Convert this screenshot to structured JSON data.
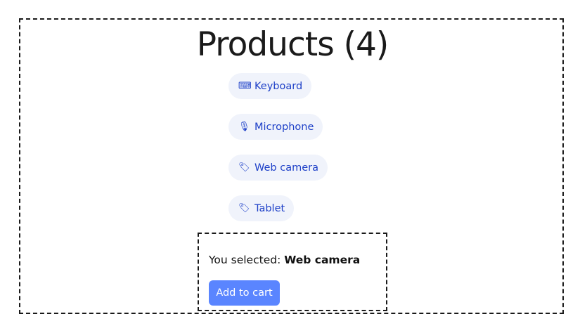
{
  "page": {
    "title": "Products (4)"
  },
  "products": [
    {
      "icon": "⌨",
      "icon_name": "keyboard-icon",
      "label": "Keyboard"
    },
    {
      "icon": "🎙",
      "icon_name": "microphone-icon",
      "label": "Microphone"
    },
    {
      "icon": "🏷",
      "icon_name": "tag-icon",
      "label": "Web camera"
    },
    {
      "icon": "🏷",
      "icon_name": "tag-icon",
      "label": "Tablet"
    }
  ],
  "selection": {
    "prefix": "You selected: ",
    "value": "Web camera",
    "button_label": "Add to cart"
  },
  "colors": {
    "accent": "#5a85ff",
    "link": "#1e40c8",
    "pill_background": "#f0f3fb"
  }
}
